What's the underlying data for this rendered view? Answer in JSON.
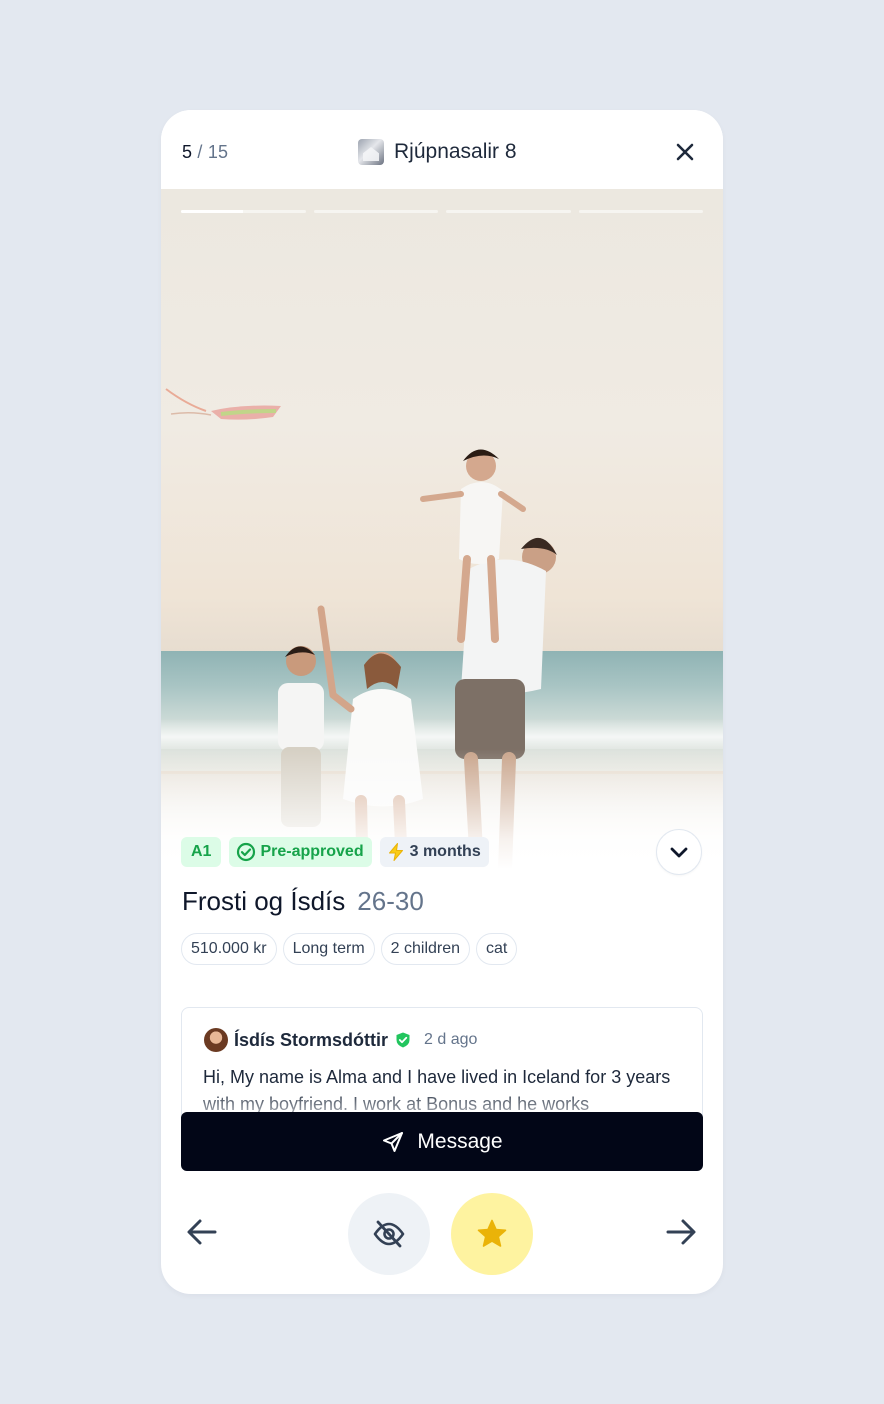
{
  "header": {
    "counter_current": "5",
    "counter_total": "/ 15",
    "property_title": "Rjúpnasalir 8",
    "close_icon": "close-icon"
  },
  "photo": {
    "description_icon": "family-beach-photo",
    "story_segments": 4,
    "active_segment": 1,
    "active_segment_progress": 0.5
  },
  "chips": {
    "level": "A1",
    "pre_approved": "Pre-approved",
    "duration": "3 months"
  },
  "applicant": {
    "name": "Frosti og Ísdís",
    "age_range": "26-30"
  },
  "tags": [
    "510.000 kr",
    "Long term",
    "2 children",
    "cat"
  ],
  "message_preview": {
    "author": "Ísdís Stormsdóttir",
    "time": "2 d ago",
    "body": "Hi, My name is Alma and I have lived in Iceland for 3 years with my boyfriend. I work at Bonus and he works"
  },
  "actions": {
    "message_label": "Message"
  },
  "colors": {
    "primary_button": "#020617",
    "pre_approved_green": "#16a34a",
    "favorite_yellow": "#fef3a0",
    "star": "#eab308"
  }
}
